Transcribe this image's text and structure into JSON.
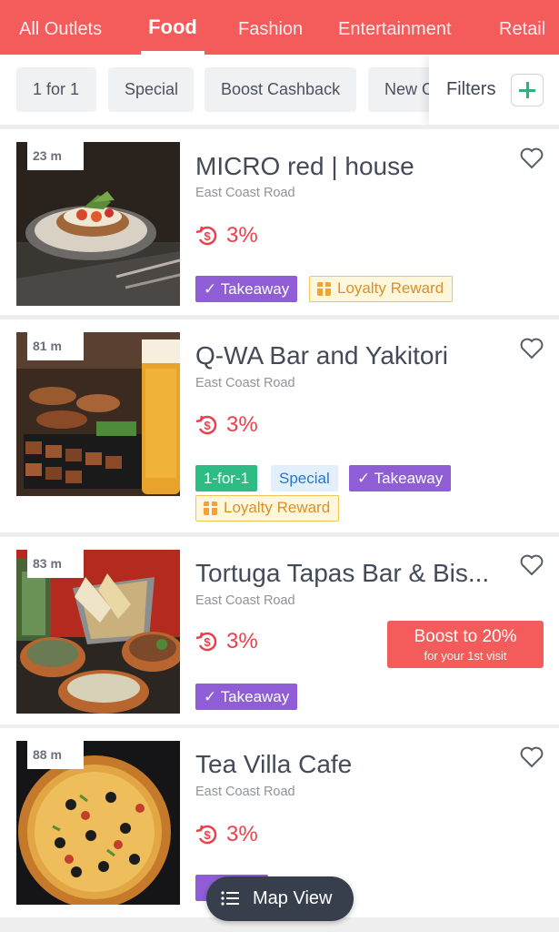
{
  "tabs": [
    {
      "label": "All Outlets"
    },
    {
      "label": "Food"
    },
    {
      "label": "Fashion"
    },
    {
      "label": "Entertainment"
    },
    {
      "label": "Retail"
    }
  ],
  "chips": [
    {
      "label": "1 for 1"
    },
    {
      "label": "Special"
    },
    {
      "label": "Boost Cashback"
    },
    {
      "label": "New O"
    }
  ],
  "filters": {
    "label": "Filters"
  },
  "outlets": [
    {
      "distance": "23 m",
      "name": "MICRO red | house",
      "location": "East Coast Road",
      "cashback": "3%",
      "tags": [
        "✓ Takeaway",
        "Loyalty Reward"
      ]
    },
    {
      "distance": "81 m",
      "name": "Q-WA Bar and Yakitori",
      "location": "East Coast Road",
      "cashback": "3%",
      "tags": [
        "1-for-1",
        "Special",
        "✓ Takeaway",
        "Loyalty Reward"
      ]
    },
    {
      "distance": "83 m",
      "name": "Tortuga Tapas Bar & Bis...",
      "location": "East Coast Road",
      "cashback": "3%",
      "boost": {
        "main": "Boost to 20%",
        "sub": "for your 1st visit"
      },
      "tags": [
        "✓ Takeaway"
      ]
    },
    {
      "distance": "88 m",
      "name": "Tea Villa Cafe",
      "location": "East Coast Road",
      "cashback": "3%",
      "tags": []
    }
  ],
  "map_view": {
    "label": "Map View"
  },
  "colors": {
    "brand_red": "#f45b5b",
    "takeaway_purple": "#8f5ed6",
    "oneforone_green": "#2dbd84",
    "cashback_red": "#e8414c"
  }
}
